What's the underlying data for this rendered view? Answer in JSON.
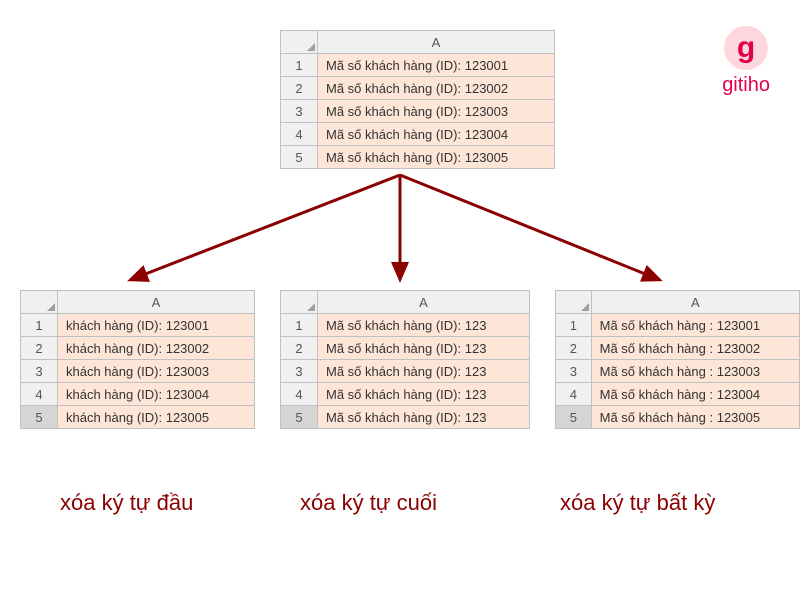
{
  "branding": {
    "logo_letter": "g",
    "logo_text": "gitiho"
  },
  "column_header": "A",
  "top_table": {
    "rows": [
      "Mã số khách hàng (ID): 123001",
      "Mã số khách hàng (ID): 123002",
      "Mã số khách hàng (ID): 123003",
      "Mã số khách hàng (ID): 123004",
      "Mã số khách hàng (ID): 123005"
    ]
  },
  "left_table": {
    "rows": [
      "khách hàng (ID): 123001",
      "khách hàng (ID): 123002",
      "khách hàng (ID): 123003",
      "khách hàng (ID): 123004",
      "khách hàng (ID): 123005"
    ],
    "selected_row": 5
  },
  "middle_table": {
    "rows": [
      "Mã số khách hàng (ID): 123",
      "Mã số khách hàng (ID): 123",
      "Mã số khách hàng (ID): 123",
      "Mã số khách hàng (ID): 123",
      "Mã số khách hàng (ID): 123"
    ],
    "selected_row": 5
  },
  "right_table": {
    "rows": [
      "Mã số khách hàng : 123001",
      "Mã số khách hàng : 123002",
      "Mã số khách hàng : 123003",
      "Mã số khách hàng : 123004",
      "Mã số khách hàng : 123005"
    ],
    "selected_row": 5
  },
  "captions": {
    "left": "xóa ký tự đầu",
    "middle": "xóa ký tự cuối",
    "right": "xóa ký tự bất kỳ"
  },
  "colors": {
    "accent": "#8b0000",
    "cell_bg": "#fde5d7",
    "brand": "#e6004c"
  }
}
